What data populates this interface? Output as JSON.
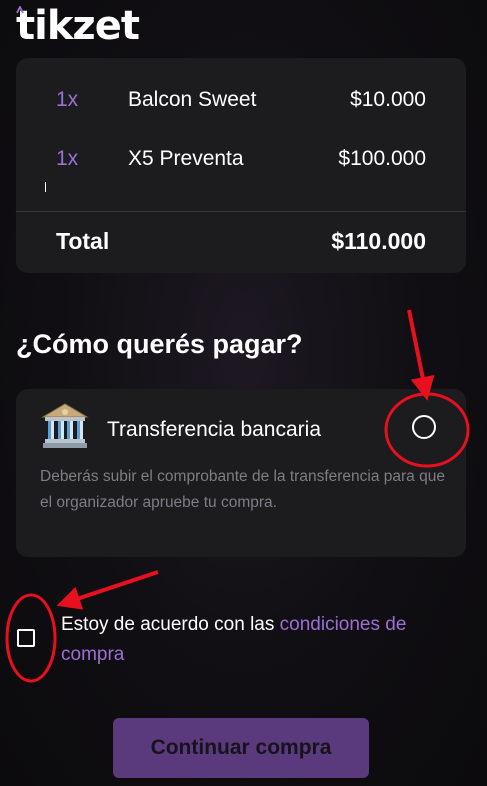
{
  "brand": {
    "logo_text": "tikzet",
    "accent": "#9b6fd6"
  },
  "order": {
    "items": [
      {
        "qty": "1x",
        "name": "Balcon Sweet",
        "price": "$10.000"
      },
      {
        "qty": "1x",
        "name": "X5 Preventa",
        "price": "$100.000"
      }
    ],
    "total_label": "Total",
    "total_value": "$110.000"
  },
  "payment": {
    "title": "¿Cómo querés pagar?",
    "options": [
      {
        "icon": "bank-icon",
        "label": "Transferencia bancaria",
        "description": "Deberás subir el comprobante de la transferencia para que el organizador apruebe tu compra.",
        "selected": false
      }
    ]
  },
  "terms": {
    "checked": false,
    "text": "Estoy de acuerdo con las ",
    "link": "condiciones de compra"
  },
  "cta": {
    "label": "Continuar compra",
    "color": "#5a3a7c"
  },
  "annotations": {
    "color": "#e8101e"
  }
}
